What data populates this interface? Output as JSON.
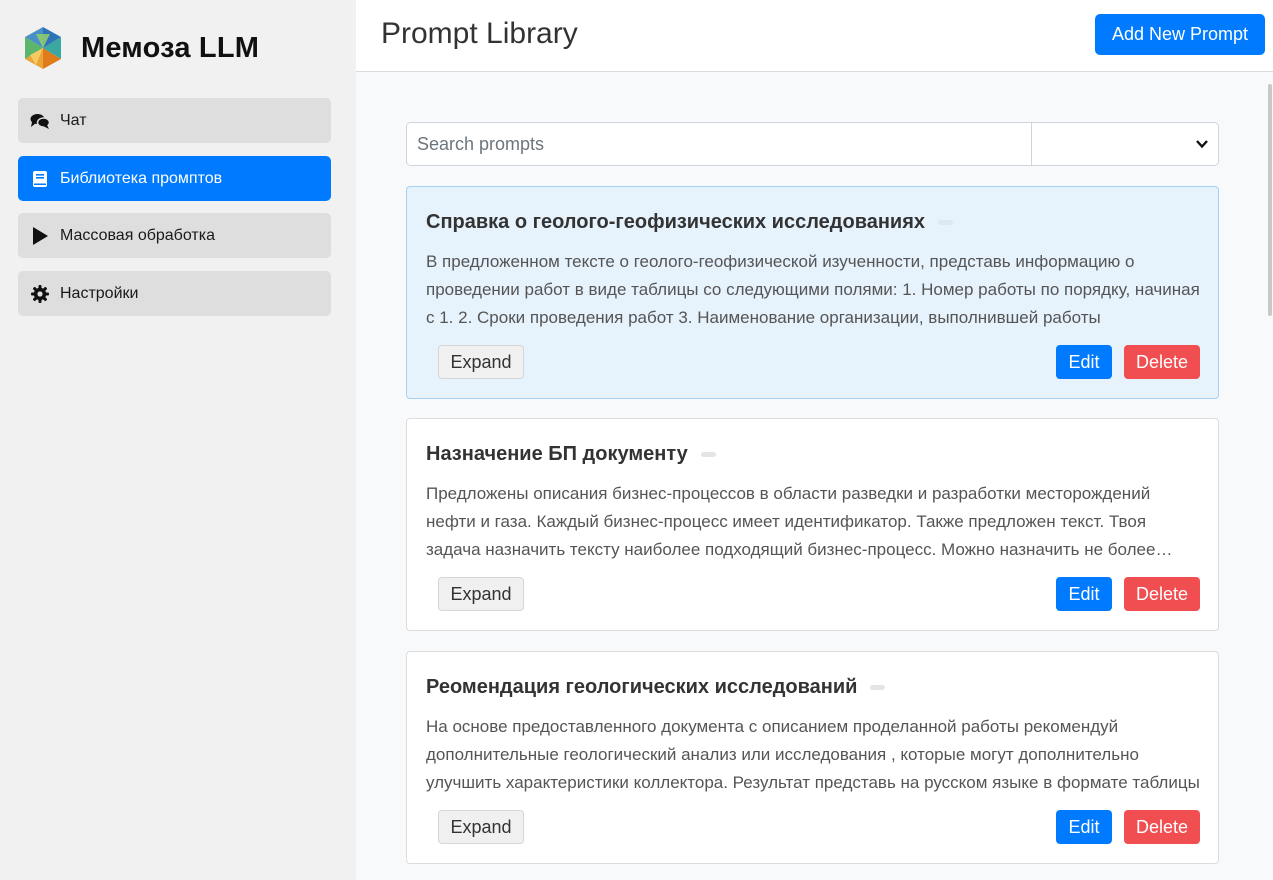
{
  "app": {
    "brand_name": "Мемоза LLM",
    "accent_color": "#007bff",
    "danger_color": "#f04e50"
  },
  "sidebar": {
    "items": [
      {
        "label": "Чат",
        "icon": "chat-icon",
        "active": false
      },
      {
        "label": "Библиотека промптов",
        "icon": "book-icon",
        "active": true
      },
      {
        "label": "Массовая обработка",
        "icon": "play-icon",
        "active": false
      },
      {
        "label": "Настройки",
        "icon": "gear-icon",
        "active": false
      }
    ]
  },
  "header": {
    "title": "Prompt Library",
    "add_button_label": "Add New Prompt"
  },
  "search": {
    "placeholder": "Search prompts",
    "value": "",
    "filter_selected": ""
  },
  "prompts": [
    {
      "title": "Справка о геолого-геофизических исследованиях",
      "description": "В предложенном тексте о геолого-геофизической изученности, представь информацию о проведении работ в виде таблицы со следующими полями: 1. Номер работы по порядку, начиная с 1. 2. Сроки проведения работ 3. Наименование организации, выполнившей работы",
      "highlighted": true,
      "expand_label": "Expand",
      "edit_label": "Edit",
      "delete_label": "Delete"
    },
    {
      "title": "Назначение БП документу",
      "description": "Предложены описания бизнес-процессов в области разведки и разработки месторождений нефти и газа. Каждый бизнес-процесс имеет идентификатор. Также предложен текст. Твоя задача назначить тексту наиболее подходящий бизнес-процесс. Можно назначить не более одного",
      "highlighted": false,
      "expand_label": "Expand",
      "edit_label": "Edit",
      "delete_label": "Delete"
    },
    {
      "title": "Реомендация геологических исследований",
      "description": "На основе предоставленного документа с описанием проделанной работы рекомендуй дополнительные геологический анализ или исследования , которые могут дополнительно улучшить характеристики коллектора. Результат представь на русском языке в формате таблицы",
      "highlighted": false,
      "expand_label": "Expand",
      "edit_label": "Edit",
      "delete_label": "Delete"
    }
  ]
}
